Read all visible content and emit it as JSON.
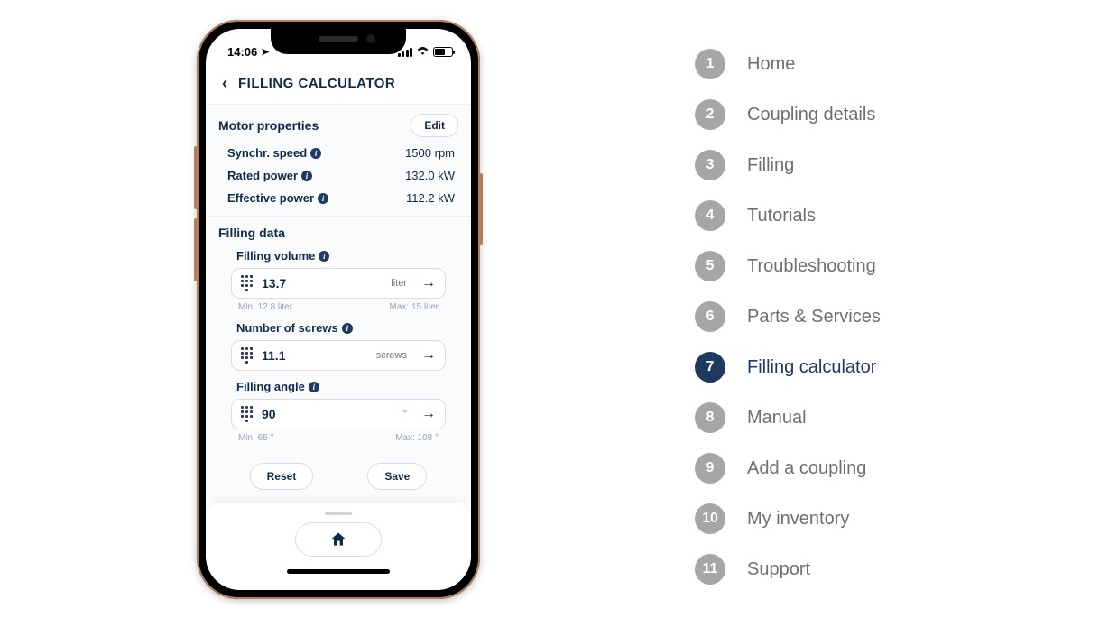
{
  "status": {
    "time": "14:06"
  },
  "header": {
    "title": "FILLING CALCULATOR"
  },
  "motor": {
    "section_title": "Motor properties",
    "edit_label": "Edit",
    "rows": [
      {
        "label": "Synchr. speed",
        "value": "1500 rpm"
      },
      {
        "label": "Rated power",
        "value": "132.0 kW"
      },
      {
        "label": "Effective power",
        "value": "112.2 kW"
      }
    ]
  },
  "filling": {
    "section_title": "Filling data",
    "fields": [
      {
        "label": "Filling volume",
        "value": "13.7",
        "unit": "liter",
        "min": "Min: 12.8 liter",
        "max": "Max: 15 liter"
      },
      {
        "label": "Number of screws",
        "value": "11.1",
        "unit": "screws",
        "min": "",
        "max": ""
      },
      {
        "label": "Filling angle",
        "value": "90",
        "unit": "°",
        "min": "Min: 65 °",
        "max": "Max: 108 °"
      }
    ]
  },
  "actions": {
    "reset": "Reset",
    "save": "Save"
  },
  "legend": {
    "items": [
      {
        "num": "1",
        "label": "Home"
      },
      {
        "num": "2",
        "label": "Coupling details"
      },
      {
        "num": "3",
        "label": "Filling"
      },
      {
        "num": "4",
        "label": "Tutorials"
      },
      {
        "num": "5",
        "label": "Troubleshooting"
      },
      {
        "num": "6",
        "label": "Parts & Services"
      },
      {
        "num": "7",
        "label": "Filling calculator"
      },
      {
        "num": "8",
        "label": "Manual"
      },
      {
        "num": "9",
        "label": "Add a coupling"
      },
      {
        "num": "10",
        "label": "My inventory"
      },
      {
        "num": "11",
        "label": "Support"
      }
    ],
    "active_index": 6
  }
}
